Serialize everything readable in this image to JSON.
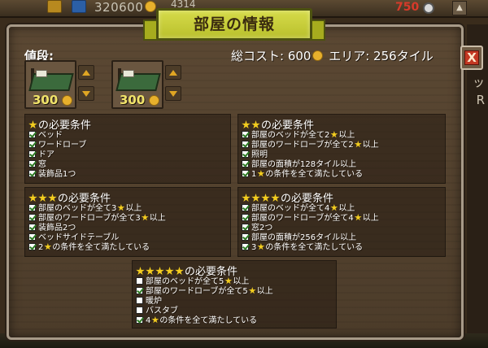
{
  "hud": {
    "money": "320600",
    "population": "4314",
    "lives": "750",
    "side_text_1": "ッ",
    "side_text_2": "R"
  },
  "dialog": {
    "title": "部屋の情報",
    "price_label": "値段:",
    "total_cost_prefix": "総コスト: ",
    "total_cost_value": "600",
    "area_text": " エリア: 256タイル",
    "close_label": "X"
  },
  "items": [
    {
      "name": "bed",
      "price": "300"
    },
    {
      "name": "bed",
      "price": "300"
    }
  ],
  "requirements": [
    {
      "stars": 1,
      "title_suffix": "の必要条件",
      "items": [
        {
          "text_before": "ベッド",
          "checked": true
        },
        {
          "text_before": "ワードローブ",
          "checked": true
        },
        {
          "text_before": "ドア",
          "checked": true
        },
        {
          "text_before": "窓",
          "checked": true
        },
        {
          "text_before": "装飾品1つ",
          "checked": true
        }
      ]
    },
    {
      "stars": 2,
      "title_suffix": "の必要条件",
      "items": [
        {
          "text_before": "部屋のベッドが全て2",
          "has_star": true,
          "text_after": "以上",
          "checked": true
        },
        {
          "text_before": "部屋のワードローブが全て2",
          "has_star": true,
          "text_after": "以上",
          "checked": true
        },
        {
          "text_before": "照明",
          "checked": true
        },
        {
          "text_before": "部屋の面積が128タイル以上",
          "checked": true
        },
        {
          "text_before": "1",
          "has_star": true,
          "text_after": "の条件を全て満たしている",
          "checked": true
        }
      ]
    },
    {
      "stars": 3,
      "title_suffix": "の必要条件",
      "items": [
        {
          "text_before": "部屋のベッドが全て3",
          "has_star": true,
          "text_after": "以上",
          "checked": true
        },
        {
          "text_before": "部屋のワードローブが全て3",
          "has_star": true,
          "text_after": "以上",
          "checked": true
        },
        {
          "text_before": "装飾品2つ",
          "checked": true
        },
        {
          "text_before": "ベッドサイドテーブル",
          "checked": true
        },
        {
          "text_before": "2",
          "has_star": true,
          "text_after": "の条件を全て満たしている",
          "checked": true
        }
      ]
    },
    {
      "stars": 4,
      "title_suffix": "の必要条件",
      "items": [
        {
          "text_before": "部屋のベッドが全て4",
          "has_star": true,
          "text_after": "以上",
          "checked": true
        },
        {
          "text_before": "部屋のワードローブが全て4",
          "has_star": true,
          "text_after": "以上",
          "checked": true
        },
        {
          "text_before": "窓2つ",
          "checked": true
        },
        {
          "text_before": "部屋の面積が256タイル以上",
          "checked": true
        },
        {
          "text_before": "3",
          "has_star": true,
          "text_after": "の条件を全て満たしている",
          "checked": true
        }
      ]
    },
    {
      "stars": 5,
      "title_suffix": "の必要条件",
      "items": [
        {
          "text_before": "部屋のベッドが全て5",
          "has_star": true,
          "text_after": "以上",
          "checked": false
        },
        {
          "text_before": "部屋のワードローブが全て5",
          "has_star": true,
          "text_after": "以上",
          "checked": true
        },
        {
          "text_before": "暖炉",
          "checked": false
        },
        {
          "text_before": "バスタブ",
          "checked": false
        },
        {
          "text_before": "4",
          "has_star": true,
          "text_after": "の条件を全て満たしている",
          "checked": true
        }
      ]
    }
  ],
  "colors": {
    "banner": "#c8cd3a",
    "star": "#f3cd1f",
    "lives": "#d83a2a",
    "price_text": "#f1e46a"
  }
}
